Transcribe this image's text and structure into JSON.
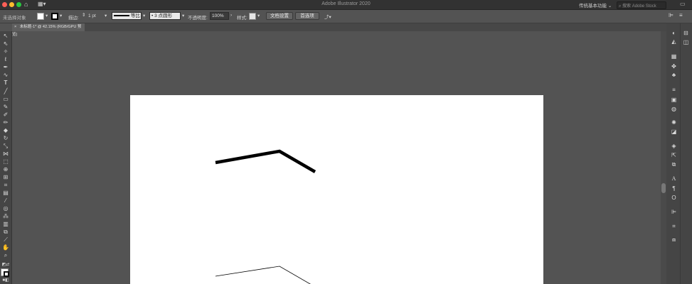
{
  "window": {
    "title": "Adobe Illustrator 2020"
  },
  "header": {
    "workspace": "传统基本功能",
    "search_placeholder": "搜索 Adobe Stock"
  },
  "control_bar": {
    "selection_label": "未选择对象",
    "stroke_label": "描边:",
    "stroke_weight": "1 pt",
    "profile_label": "等比",
    "brush_label": "3 点圆形",
    "opacity_label": "不透明度:",
    "opacity_value": "100%",
    "style_label": "样式:",
    "doc_setup": "文档设置",
    "preferences": "首选项"
  },
  "document_tab": {
    "label": "未标题-1* @ 42.15% (RGB/GPU 预览)"
  },
  "colors": {
    "accent_close": "#fe5f57",
    "accent_min": "#febc2e",
    "accent_max": "#28c840",
    "stroke": "#000000",
    "artboard": "#ffffff"
  },
  "tools": [
    "selection-icon",
    "direct-selection-icon",
    "magic-wand-icon",
    "lasso-icon",
    "pen-icon",
    "curvature-icon",
    "type-icon",
    "line-icon",
    "rectangle-icon",
    "paintbrush-icon",
    "shaper-icon",
    "pencil-icon",
    "eraser-icon",
    "rotate-icon",
    "scale-icon",
    "width-icon",
    "free-transform-icon",
    "shape-builder-icon",
    "perspective-icon",
    "mesh-icon",
    "gradient-icon",
    "eyedropper-icon",
    "blend-icon",
    "symbol-sprayer-icon",
    "column-graph-icon",
    "artboard-icon",
    "slice-icon",
    "hand-icon",
    "zoom-icon"
  ],
  "panels": [
    "color-icon",
    "color-guide-icon",
    "swatches-icon",
    "brushes-icon",
    "symbols-icon",
    "stroke-icon",
    "gradient-icon",
    "transparency-icon",
    "appearance-icon",
    "graphic-styles-icon",
    "layers-icon",
    "asset-export-icon",
    "artboards-icon",
    "character-icon",
    "paragraph-icon",
    "opentype-icon",
    "align-icon",
    "transform-icon",
    "pathfinder-icon"
  ]
}
